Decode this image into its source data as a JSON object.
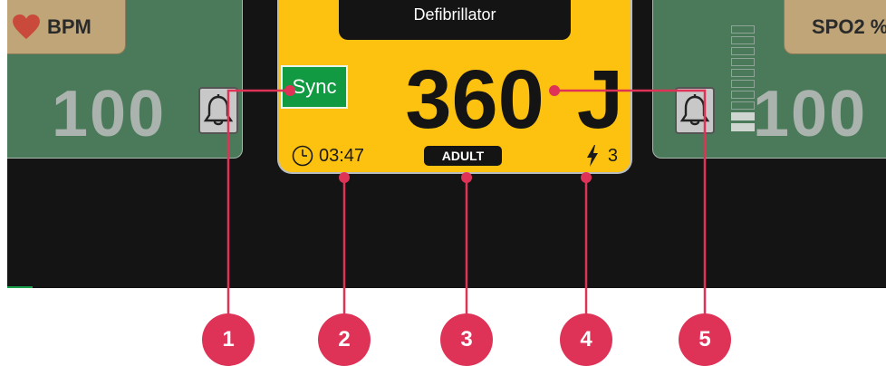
{
  "left_panel": {
    "label": "BPM",
    "value": "100",
    "icon": "heart-icon",
    "alarm_icon": "bell-icon"
  },
  "right_panel": {
    "label": "SPO2 %",
    "value": "100",
    "alarm_icon": "bell-icon",
    "signal_icon": "signal-strength-icon",
    "signal_level": 0.2
  },
  "defibrillator": {
    "title": "Defibrillator",
    "sync_label": "Sync",
    "energy_value": "360",
    "energy_unit": "J",
    "timer_icon": "clock-icon",
    "timer": "03:47",
    "patient_mode": "ADULT",
    "shock_icon": "lightning-bolt-icon",
    "shock_count": "3"
  },
  "colors": {
    "accent": "#fdc20f",
    "panel": "#4b7a5a",
    "callout": "#df3257",
    "sync": "#129a43"
  },
  "callouts": [
    "1",
    "2",
    "3",
    "4",
    "5"
  ]
}
